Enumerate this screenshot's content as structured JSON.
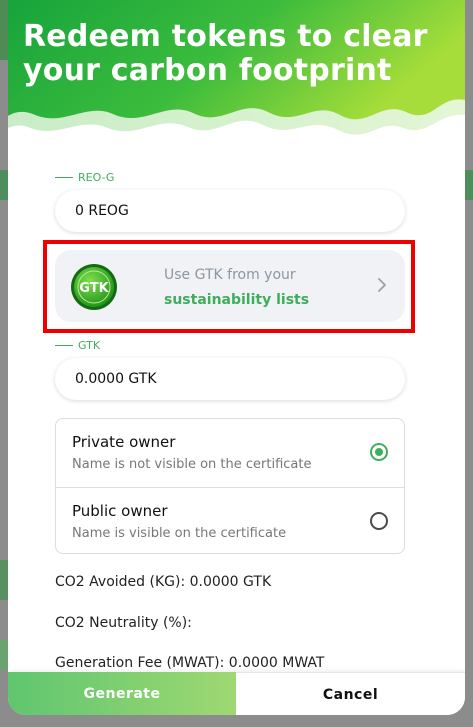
{
  "modal": {
    "title": "Redeem tokens to clear your carbon footprint"
  },
  "reog": {
    "label": "REO-G",
    "value": "0 REOG"
  },
  "gtk_card": {
    "coin_text": "GTK",
    "line1": "Use GTK from your",
    "line2": "sustainability lists",
    "icon": "chevron-right-icon"
  },
  "gtk": {
    "label": "GTK",
    "value": "0.0000 GTK"
  },
  "owner": {
    "options": [
      {
        "title": "Private owner",
        "subtitle": "Name is not visible on the certificate",
        "selected": true
      },
      {
        "title": "Public owner",
        "subtitle": "Name is visible on the certificate",
        "selected": false
      }
    ]
  },
  "stats": {
    "co2_avoided": "CO2 Avoided (KG): 0.0000 GTK",
    "co2_neutrality": "CO2 Neutrality (%):",
    "generation_fee": "Generation Fee (MWAT): 0.0000 MWAT"
  },
  "footer": {
    "generate": "Generate",
    "cancel": "Cancel"
  },
  "colors": {
    "accent": "#3fae5c",
    "highlight": "#ee0000"
  }
}
